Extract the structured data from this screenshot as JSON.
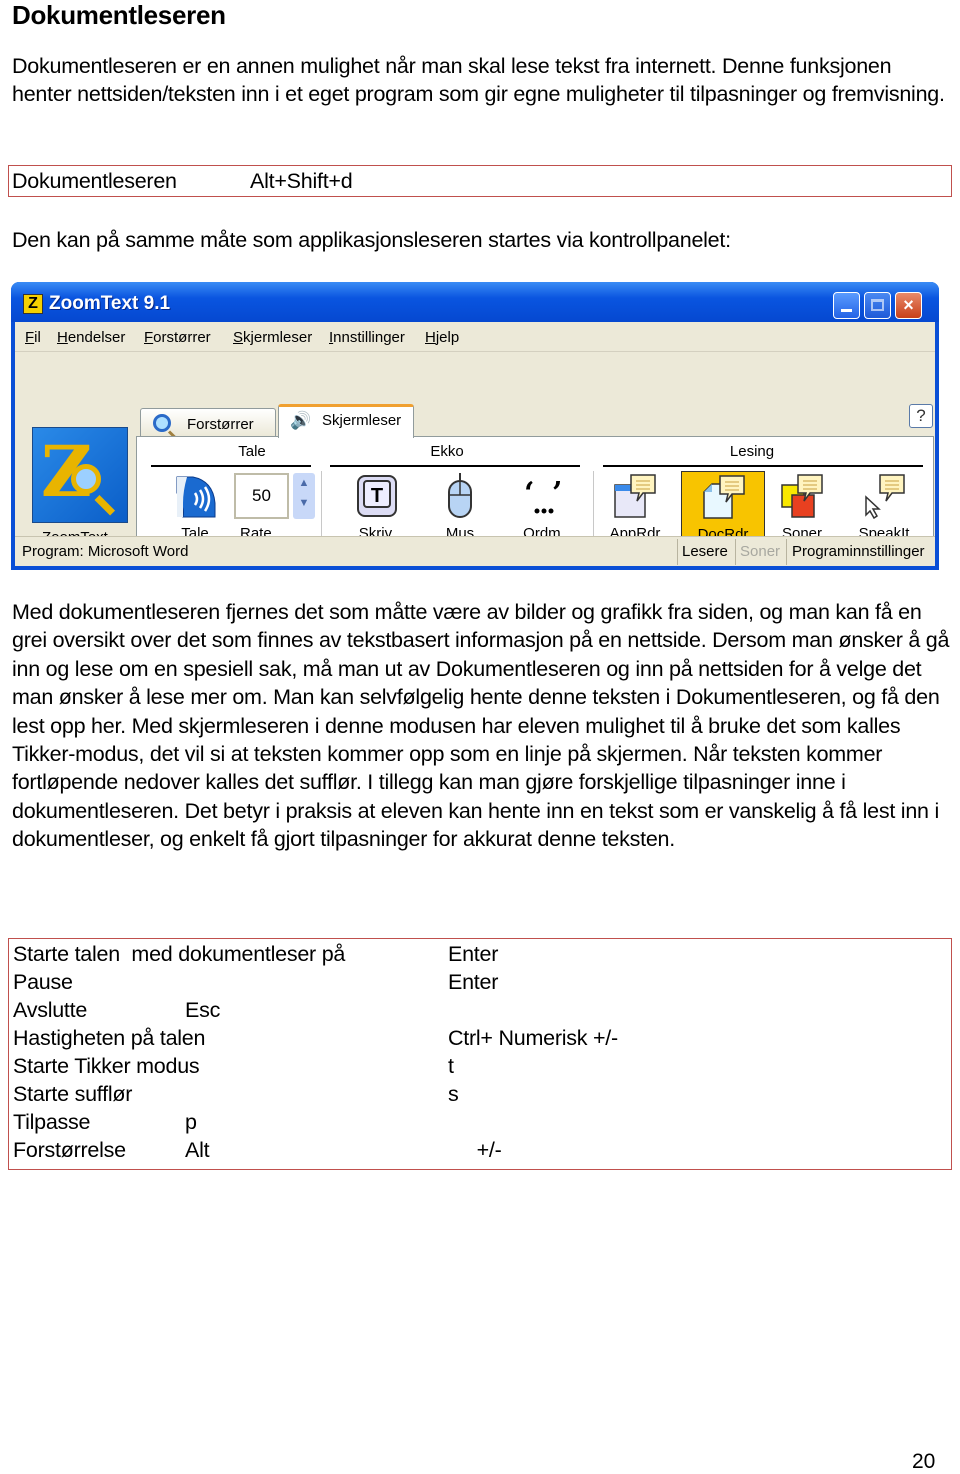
{
  "heading": "Dokumentleseren",
  "intro_paragraph": "Dokumentleseren er en annen mulighet når man skal lese tekst fra internett. Denne funksjonen henter nettsiden/teksten inn i et eget program som gir egne muligheter til tilpasninger og fremvisning.",
  "shortcut_box": {
    "label": "Dokumentleseren",
    "keys": "Alt+Shift+d",
    "border_color": "#c0504d"
  },
  "lead_paragraph": "Den kan på samme måte som applikasjonsleseren startes via kontrollpanelet:",
  "zoomtext_window": {
    "title": "ZoomText 9.1",
    "logo_letter": "Z",
    "window_buttons": {
      "minimize": "minimize",
      "maximize": "maximize",
      "close": "×"
    },
    "menu": [
      {
        "label": "Fil",
        "accel": "F",
        "rest": "il"
      },
      {
        "label": "Hendelser",
        "accel": "H",
        "rest": "endelser"
      },
      {
        "label": "Forstørrer",
        "accel": "F",
        "rest": "orstørrer"
      },
      {
        "label": "Skjermleser",
        "accel": "S",
        "rest": "kjermleser"
      },
      {
        "label": "Innstillinger",
        "accel": "I",
        "rest": "nnstillinger"
      },
      {
        "label": "Hjelp",
        "accel": "H",
        "rest": "jelp"
      }
    ],
    "help_button": "?",
    "brand_label": "ZoomText",
    "tabs": [
      {
        "label": "Forstørrer",
        "icon": "magnifier-icon",
        "active": false
      },
      {
        "label": "Skjermleser",
        "icon": "speaker-icon",
        "active": true
      }
    ],
    "groups": {
      "tale": "Tale",
      "ekko": "Ekko",
      "lesing": "Lesing"
    },
    "tools": {
      "tale": "Tale",
      "rate_value": "50",
      "rate_label": "Rate",
      "skriv": "Skriv.",
      "skriv_glyph": "T",
      "mus": "Mus",
      "ordm": "Ordm.",
      "apprdr": "AppRdr",
      "docrdr": "DocRdr",
      "soner": "Soner",
      "speakit": "SpeakIt"
    },
    "selected_tool": "DocRdr",
    "selected_color": "#f8c400",
    "status": {
      "program": "Program:  Microsoft Word",
      "lesere": "Lesere",
      "soner": "Soner",
      "programinnstillinger": "Programinnstillinger"
    }
  },
  "body_paragraph": "Med dokumentleseren fjernes det som måtte være av bilder og grafikk fra siden, og man kan få en grei oversikt over det som finnes av tekstbasert informasjon på en nettside. Dersom man ønsker å gå inn og lese om en spesiell sak, må man ut av Dokumentleseren og inn på nettsiden for å velge det man ønsker å lese mer om. Man kan selvfølgelig hente denne teksten i Dokumentleseren, og få den lest opp her. Med skjermleseren i denne modusen har eleven mulighet til å bruke det som kalles Tikker-modus, det vil si at teksten kommer opp som en linje på skjermen. Når teksten kommer fortløpende nedover kalles det sufflør. I tillegg kan man gjøre forskjellige tilpasninger inne i dokumentleseren. Det betyr i praksis at eleven kan hente inn en tekst som er vanskelig å få lest inn i dokumentleser, og enkelt få gjort tilpasninger for akkurat denne teksten.",
  "shortcuts_table": [
    {
      "action": "Starte talen  med dokumentleser på",
      "mid": "",
      "key": "Enter"
    },
    {
      "action": "Pause",
      "mid": "",
      "key": "Enter"
    },
    {
      "action": "Avslutte",
      "mid": "Esc",
      "key": ""
    },
    {
      "action": "Hastigheten på talen",
      "mid": "",
      "key": "Ctrl+ Numerisk +/-"
    },
    {
      "action": "Starte Tikker modus",
      "mid": "",
      "key": "t"
    },
    {
      "action": "Starte sufflør",
      "mid": "",
      "key": "s"
    },
    {
      "action": "Tilpasse",
      "mid": "p",
      "key": ""
    },
    {
      "action": "Forstørrelse",
      "mid": "Alt",
      "key": "     +/-"
    }
  ],
  "page_number": "20"
}
